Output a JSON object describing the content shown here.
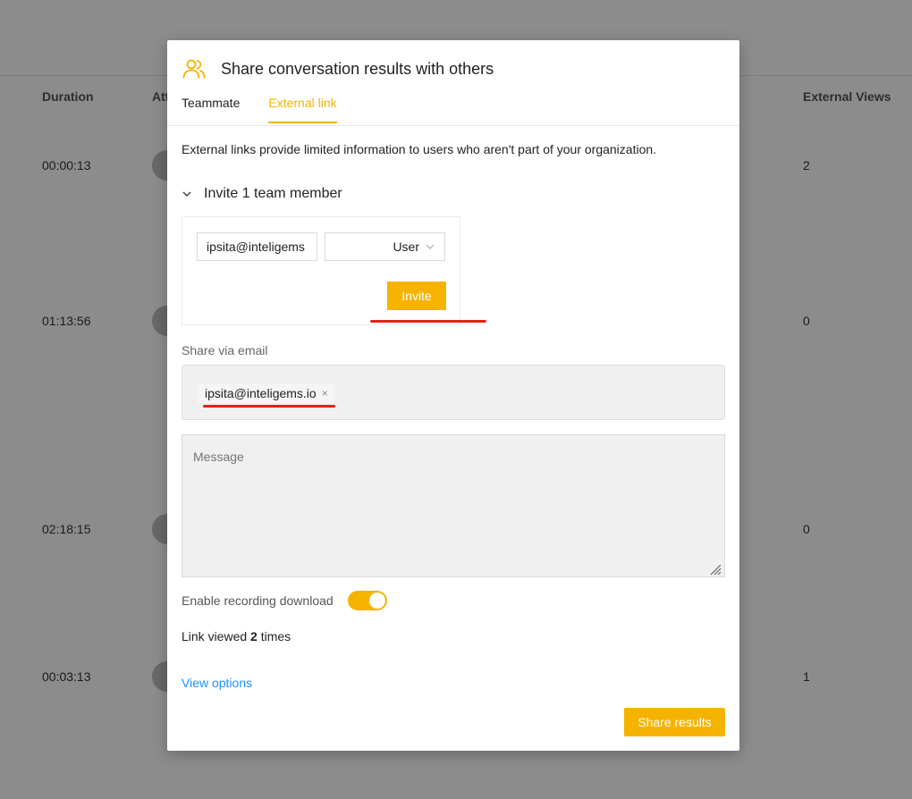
{
  "background": {
    "columns": {
      "duration": "Duration",
      "attendees": "Att",
      "external_views": "External Views"
    },
    "rows": [
      {
        "duration": "00:00:13",
        "views": "2"
      },
      {
        "duration": "01:13:56",
        "views": "0"
      },
      {
        "duration": "02:18:15",
        "views": "0"
      },
      {
        "duration": "00:03:13",
        "views": "1"
      }
    ]
  },
  "modal": {
    "icon": "people-icon",
    "title": "Share conversation results with others",
    "tabs": [
      {
        "label": "Teammate",
        "active": false
      },
      {
        "label": "External link",
        "active": true
      }
    ],
    "description": "External links provide limited information to users who aren't part of your organization.",
    "invite": {
      "title": "Invite 1 team member",
      "email_value": "ipsita@inteligems",
      "role_value": "User",
      "invite_label": "Invite"
    },
    "share_email": {
      "label": "Share via email",
      "chip": "ipsita@inteligems.io",
      "chip_close": "×"
    },
    "message": {
      "placeholder": "Message"
    },
    "toggle": {
      "label": "Enable recording download",
      "enabled": true
    },
    "link_viewed": {
      "prefix": "Link viewed",
      "count": "2",
      "suffix": "times"
    },
    "view_options": "View options",
    "share_button": "Share results"
  },
  "colors": {
    "accent": "#f5b300",
    "link": "#1890ff",
    "annotation": "#e2231a"
  }
}
